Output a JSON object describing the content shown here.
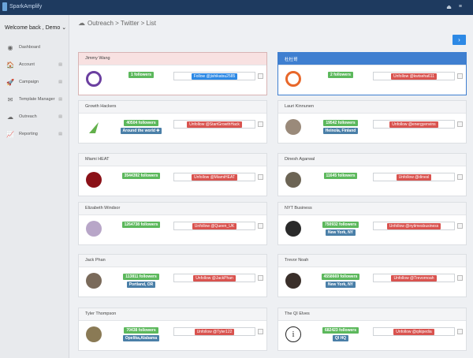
{
  "app": {
    "brand": "SparkAmplify"
  },
  "sidebar": {
    "welcome": "Welcome back , Demo",
    "welcome_caret": "⌄",
    "items": [
      {
        "label": "Dashboard",
        "icon": "◉"
      },
      {
        "label": "Account",
        "icon": "🏠"
      },
      {
        "label": "Campaign",
        "icon": "🚀"
      },
      {
        "label": "Template Manager",
        "icon": "✉"
      },
      {
        "label": "Outreach",
        "icon": "☁"
      },
      {
        "label": "Reporting",
        "icon": "📈"
      }
    ]
  },
  "breadcrumb": "Outreach > Twitter > List",
  "next_button": "›",
  "cards": [
    {
      "name": "Jimmy Wang",
      "followers": "1 followers",
      "location": "",
      "action": "Follow @jishikatsu2585",
      "action_type": "follow",
      "style": "first",
      "avatar_color": "#6b3fa0"
    },
    {
      "name": "杜杜哥",
      "followers": "2 followers",
      "location": "",
      "action": "Unfollow @kwtseha611",
      "action_type": "unfollow",
      "style": "blue",
      "avatar_color": "#e8672a"
    },
    {
      "name": "Growth Hackers",
      "followers": "40504 followers",
      "location": "Around the world ✚",
      "action": "Unfollow @StartGrowthHack",
      "action_type": "unfollow",
      "style": "",
      "avatar_color": "#62b04b"
    },
    {
      "name": "Lauri Kinnunen",
      "followers": "19542 followers",
      "location": "Heinola, Finland",
      "action": "Unfollow @energyenvins",
      "action_type": "unfollow",
      "style": "",
      "avatar_color": "#9a8a7a"
    },
    {
      "name": "Miami HEAT",
      "followers": "3544392 followers",
      "location": "",
      "action": "Unfollow @MiamiHEAT",
      "action_type": "unfollow",
      "style": "",
      "avatar_color": "#8b1118"
    },
    {
      "name": "Dinesh Agarwal",
      "followers": "11645 followers",
      "location": "",
      "action": "Unfollow @dinesl",
      "action_type": "unfollow",
      "style": "",
      "avatar_color": "#6c6454"
    },
    {
      "name": "Elizabeth Windsor",
      "followers": "1264738 followers",
      "location": "",
      "action": "Unfollow @Queen_UK",
      "action_type": "unfollow",
      "style": "",
      "avatar_color": "#b8a6c8"
    },
    {
      "name": "NYT Business",
      "followers": "750932 followers",
      "location": "New York, NY",
      "action": "Unfollow @nytimesbusiness",
      "action_type": "unfollow",
      "style": "",
      "avatar_color": "#2a2a2a"
    },
    {
      "name": "Jack Phan",
      "followers": "113811 followers",
      "location": "Portland, OR",
      "action": "Unfollow @JackPhan",
      "action_type": "unfollow",
      "style": "",
      "avatar_color": "#7a6a5a"
    },
    {
      "name": "Trevor Noah",
      "followers": "4558669 followers",
      "location": "New York, NY",
      "action": "Unfollow @Trevornoah",
      "action_type": "unfollow",
      "style": "",
      "avatar_color": "#3a2f2a"
    },
    {
      "name": "Tyler Thompson",
      "followers": "70438 followers",
      "location": "Opelika,Alabama",
      "action": "Unfollow @Tyler122",
      "action_type": "unfollow",
      "style": "",
      "avatar_color": "#8a7a55"
    },
    {
      "name": "The QI Elves",
      "followers": "682423 followers",
      "location": "QI HQ",
      "action": "Unfollow @qikipedia",
      "action_type": "unfollow",
      "style": "",
      "avatar_color": "#ffffff"
    }
  ]
}
